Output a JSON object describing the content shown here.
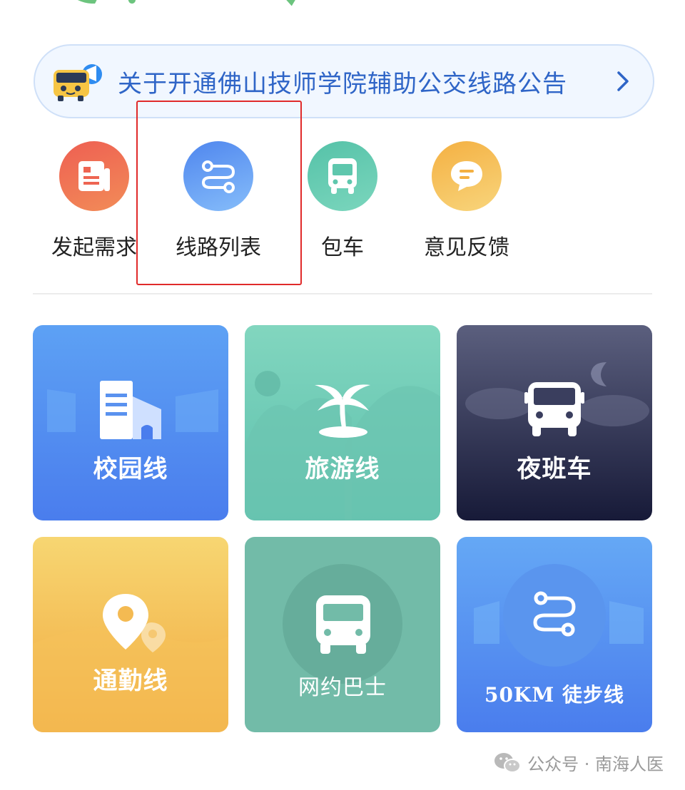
{
  "notice": {
    "text": "关于开通佛山技师学院辅助公交线路公告"
  },
  "quick_actions": [
    {
      "label": "发起需求",
      "icon": "document-icon"
    },
    {
      "label": "线路列表",
      "icon": "route-icon"
    },
    {
      "label": "包车",
      "icon": "bus-icon"
    },
    {
      "label": "意见反馈",
      "icon": "message-icon"
    }
  ],
  "cards": [
    {
      "label": "校园线",
      "icon": "campus-building-icon"
    },
    {
      "label": "旅游线",
      "icon": "palm-tree-icon"
    },
    {
      "label": "夜班车",
      "icon": "night-bus-icon"
    },
    {
      "label": "通勤线",
      "icon": "location-pin-icon"
    },
    {
      "label": "网约巴士",
      "icon": "bus-icon"
    },
    {
      "label": "50KM 徒步线",
      "icon": "route-icon"
    }
  ],
  "footer": {
    "text": "公众号 · 南海人医"
  },
  "colors": {
    "notice_text": "#2f65c7",
    "highlight_border": "#e02a2a",
    "campus": "#4f86ee",
    "tour": "#5cc0ad",
    "night": "#252a48",
    "commute": "#f3b74c",
    "ride_bus": "#6dbba5",
    "hike": "#4f86ee"
  }
}
